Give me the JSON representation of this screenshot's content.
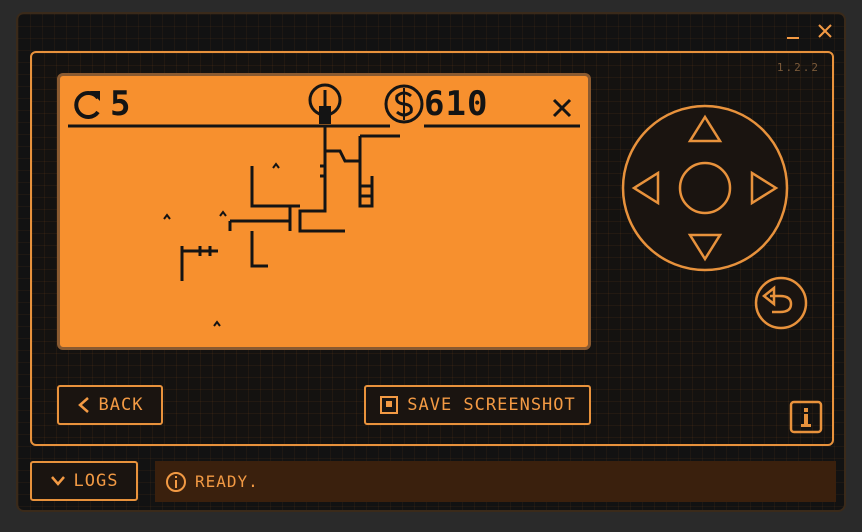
{
  "app": {
    "version": "1.2.2"
  },
  "window_controls": {
    "minimize_icon": "minimize-icon",
    "close_icon": "close-icon"
  },
  "game": {
    "moves": "5",
    "score": "610",
    "moves_icon": "rotate-icon",
    "score_icon": "dollar-icon",
    "center_icon": "bulb-icon",
    "close_icon": "close-icon"
  },
  "controls": {
    "dpad_icon": "dpad-icon",
    "undo_icon": "undo-icon"
  },
  "actions": {
    "back_label": "BACK",
    "save_label": "SAVE SCREENSHOT",
    "info_icon": "info-icon"
  },
  "footer": {
    "logs_label": "LOGS",
    "status_text": "READY."
  },
  "colors": {
    "accent": "#f39a44",
    "screen_bg": "#f7902e",
    "ink": "#141414",
    "status_bg": "#3a200d"
  }
}
